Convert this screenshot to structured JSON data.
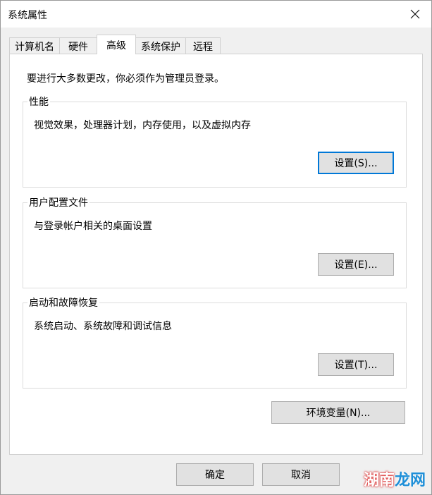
{
  "window": {
    "title": "系统属性",
    "close_icon": "close-icon"
  },
  "tabs": [
    {
      "label": "计算机名",
      "active": false
    },
    {
      "label": "硬件",
      "active": false
    },
    {
      "label": "高级",
      "active": true
    },
    {
      "label": "系统保护",
      "active": false
    },
    {
      "label": "远程",
      "active": false
    }
  ],
  "panel": {
    "admin_note": "要进行大多数更改，你必须作为管理员登录。",
    "performance": {
      "title": "性能",
      "desc": "视觉效果，处理器计划，内存使用，以及虚拟内存",
      "button": "设置(S)..."
    },
    "user_profiles": {
      "title": "用户配置文件",
      "desc": "与登录帐户相关的桌面设置",
      "button": "设置(E)..."
    },
    "startup_recovery": {
      "title": "启动和故障恢复",
      "desc": "系统启动、系统故障和调试信息",
      "button": "设置(T)..."
    },
    "env_vars_button": "环境变量(N)..."
  },
  "footer": {
    "ok": "确定",
    "cancel": "取消"
  },
  "watermark": {
    "part1": "湖南",
    "part2": "龙网"
  },
  "colors": {
    "focus": "#0078d7",
    "button_bg": "#e1e1e1",
    "panel_bg": "#ffffff"
  }
}
